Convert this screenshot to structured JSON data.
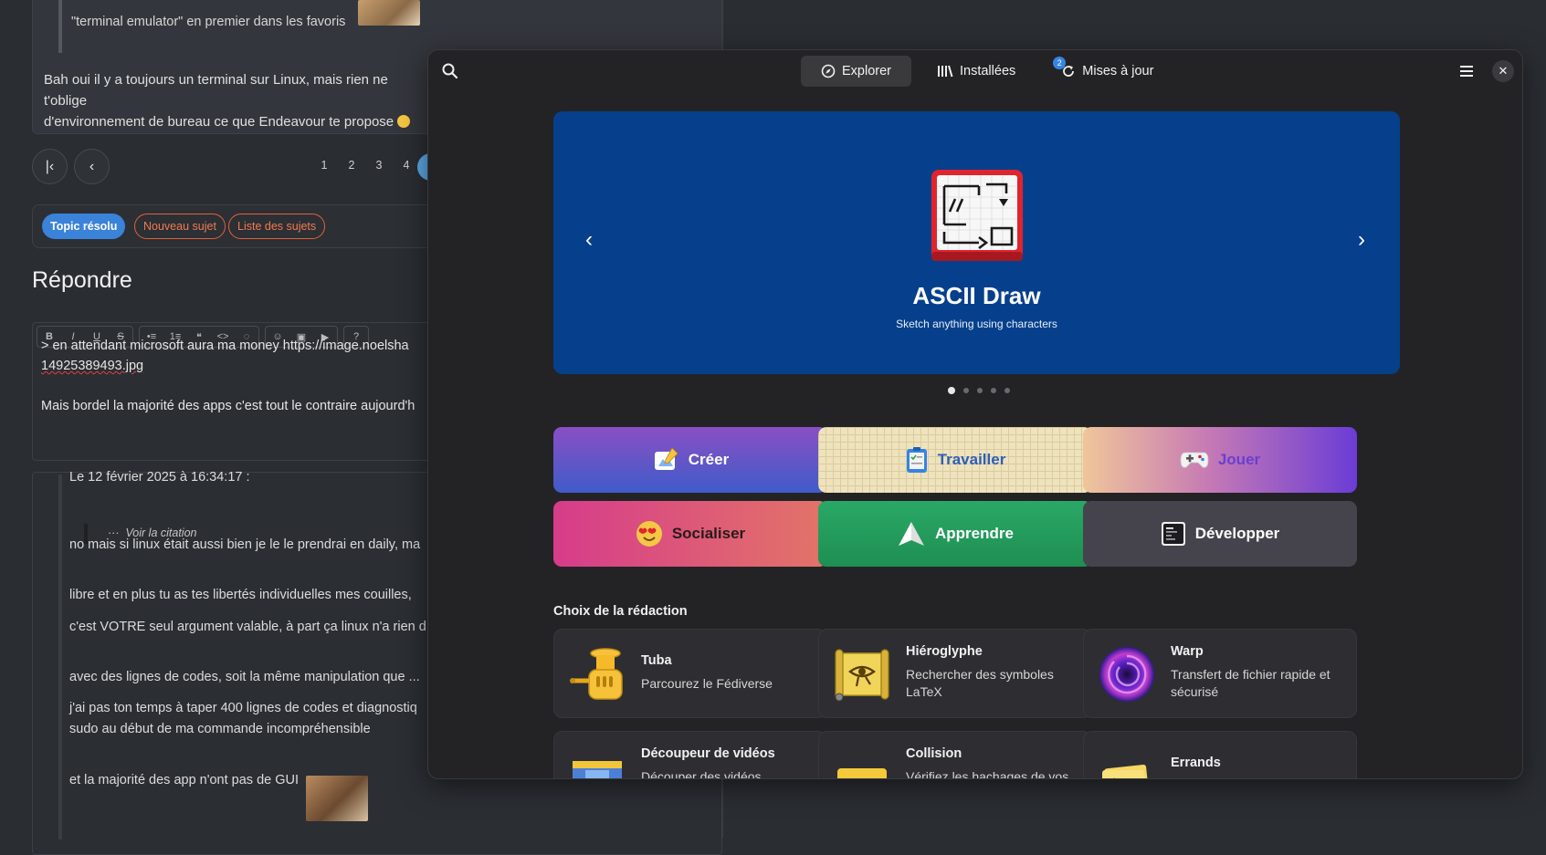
{
  "forum": {
    "quote_text": "\"terminal emulator\" en premier dans les favoris",
    "body_line1": "Bah oui il y a toujours un terminal sur Linux, mais rien ne t'oblige",
    "body_line2": "d'environnement de bureau ce que Endeavour te propose",
    "pagination": [
      "1",
      "2",
      "3",
      "4"
    ],
    "buttons": {
      "resolved": "Topic résolu",
      "new_topic": "Nouveau sujet",
      "topic_list": "Liste des sujets"
    },
    "reply_heading": "Répondre",
    "toolbar": [
      "B",
      "I",
      "U",
      "S",
      "•≡",
      "1≡",
      "❝",
      "<>",
      "◌",
      "☺",
      "▣",
      "▶",
      "?"
    ],
    "editor_line1": "> en attendant microsoft aura ma money https://image.noelsha",
    "editor_line2": "14925389493.jpg",
    "editor_line3": "Mais bordel la majorité des apps c'est tout le contraire aujourd'h",
    "post": {
      "date": "Le 12 février 2025 à 16:34:17 :",
      "see_quote": "Voir la citation",
      "lines": [
        "no mais si linux était aussi bien je le le prendrai en daily, ma",
        "libre et en plus tu as tes libertés individuelles mes couilles,",
        "c'est VOTRE seul argument valable, à part ça linux n'a rien d",
        "avec des lignes de codes, soit la même manipulation que ...",
        "j'ai pas ton temps à taper 400 lignes de codes et diagnostiq",
        "sudo au début de ma commande incompréhensible",
        "et la majorité des app n'ont pas de GUI"
      ]
    }
  },
  "software": {
    "tabs": [
      {
        "label": "Explorer",
        "icon": "compass-icon"
      },
      {
        "label": "Installées",
        "icon": "library-icon"
      },
      {
        "label": "Mises à jour",
        "icon": "update-icon",
        "badge": "2"
      }
    ],
    "carousel": {
      "title": "ASCII Draw",
      "subtitle": "Sketch anything using characters",
      "bg": "#06408c",
      "dot_count": 5,
      "active_dot": 0
    },
    "categories": [
      {
        "label": "Créer",
        "icon": "create-icon"
      },
      {
        "label": "Travailler",
        "icon": "work-icon"
      },
      {
        "label": "Jouer",
        "icon": "gamepad-icon"
      },
      {
        "label": "Socialiser",
        "icon": "emoji-icon"
      },
      {
        "label": "Apprendre",
        "icon": "paper-plane-icon"
      },
      {
        "label": "Développer",
        "icon": "terminal-icon"
      }
    ],
    "section_title": "Choix de la rédaction",
    "apps": [
      {
        "name": "Tuba",
        "desc": "Parcourez le Fédiverse"
      },
      {
        "name": "Hiéroglyphe",
        "desc": "Rechercher des symboles LaTeX"
      },
      {
        "name": "Warp",
        "desc": "Transfert de fichier rapide et sécurisé"
      },
      {
        "name": "Découpeur de vidéos",
        "desc": "Découper des vidéos"
      },
      {
        "name": "Collision",
        "desc": "Vérifiez les hachages de vos"
      },
      {
        "name": "Errands",
        "desc": ""
      }
    ]
  }
}
